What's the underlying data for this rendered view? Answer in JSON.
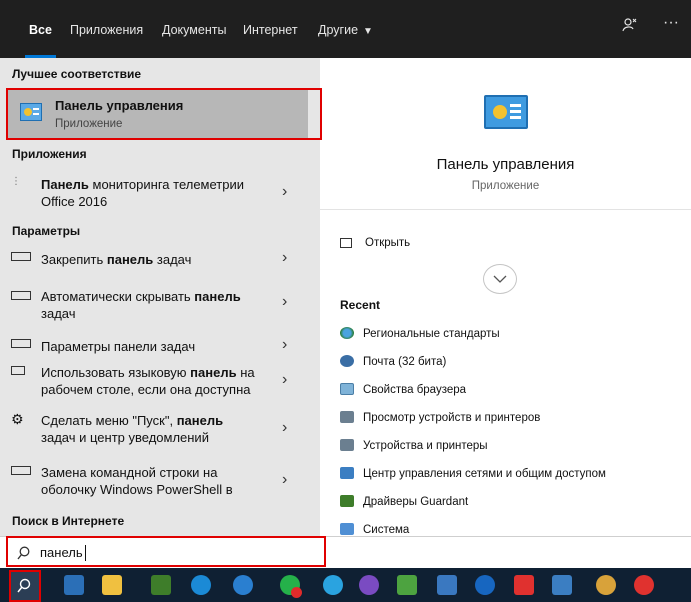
{
  "tabs": [
    {
      "label": "Все",
      "active": true
    },
    {
      "label": "Приложения"
    },
    {
      "label": "Документы"
    },
    {
      "label": "Интернет"
    },
    {
      "label": "Другие"
    }
  ],
  "topbar_icons": [
    "feedback-icon",
    "more-icon"
  ],
  "topbar_more_glyph": "···",
  "best_match": {
    "heading": "Лучшее соответствие",
    "title": "Панель управления",
    "subtitle": "Приложение"
  },
  "apps": {
    "heading": "Приложения",
    "items": [
      {
        "bold": "Панель",
        "text": " мониторинга телеметрии",
        "line2": "Office 2016"
      }
    ]
  },
  "settings": {
    "heading": "Параметры",
    "items": [
      {
        "pre": "Закрепить ",
        "bold": "панель",
        "post": " задач",
        "line2": ""
      },
      {
        "pre": "Автоматически скрывать ",
        "bold": "панель",
        "post": "",
        "line2": "задач"
      },
      {
        "pre": "Параметры панели задач",
        "bold": "",
        "post": "",
        "line2": ""
      },
      {
        "pre": "Использовать языковую ",
        "bold": "панель",
        "post": " на",
        "line2": "рабочем столе, если она доступна"
      },
      {
        "pre": "Сделать меню \"Пуск\", ",
        "bold": "панель",
        "post": "",
        "line2": "задач и центр уведомлений"
      },
      {
        "pre": "Замена командной строки на",
        "bold": "",
        "post": "",
        "line2": "оболочку Windows PowerShell в"
      }
    ]
  },
  "web": {
    "heading": "Поиск в Интернете"
  },
  "detail": {
    "title": "Панель управления",
    "subtitle": "Приложение",
    "open_label": "Открыть",
    "expand_icon": "chevron-down-icon",
    "recent_heading": "Recent",
    "recent": [
      "Региональные стандарты",
      "Почта (32 бита)",
      "Свойства браузера",
      "Просмотр устройств и принтеров",
      "Устройства и принтеры",
      "Центр управления сетями и общим доступом",
      "Драйверы Guardant",
      "Система"
    ]
  },
  "search": {
    "value": "панель",
    "icon": "search-icon"
  },
  "taskbar": {
    "apps": [
      "search",
      "calculator",
      "file-explorer",
      "app",
      "edge",
      "app",
      "whatsapp",
      "telegram",
      "viber",
      "app",
      "app",
      "teamviewer",
      "anydesk",
      "app",
      "app",
      "opera"
    ]
  },
  "colors": {
    "accent": "#0078d7",
    "highlight": "#e00000",
    "taskbar": "#0f2033"
  }
}
